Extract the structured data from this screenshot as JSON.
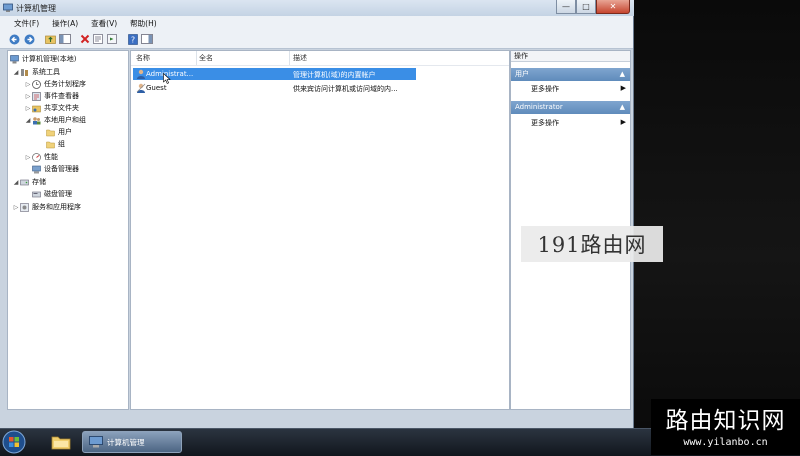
{
  "window": {
    "title": "计算机管理",
    "controls": {
      "minimize": "—",
      "maximize": "□",
      "close": "✕"
    }
  },
  "menu": [
    "文件(F)",
    "操作(A)",
    "查看(V)",
    "帮助(H)"
  ],
  "tree": {
    "items": [
      {
        "label": "计算机管理(本地)",
        "icon": "computer-management-icon"
      },
      {
        "label": "系统工具",
        "icon": "tools-icon",
        "expanded": true
      },
      {
        "label": "任务计划程序",
        "icon": "clock-icon"
      },
      {
        "label": "事件查看器",
        "icon": "event-viewer-icon"
      },
      {
        "label": "共享文件夹",
        "icon": "shared-folder-icon"
      },
      {
        "label": "本地用户和组",
        "icon": "users-icon",
        "expanded": true
      },
      {
        "label": "用户",
        "icon": "folder-icon"
      },
      {
        "label": "组",
        "icon": "folder-icon"
      },
      {
        "label": "性能",
        "icon": "performance-icon"
      },
      {
        "label": "设备管理器",
        "icon": "device-manager-icon"
      },
      {
        "label": "存储",
        "icon": "storage-icon",
        "expanded": true
      },
      {
        "label": "磁盘管理",
        "icon": "disk-icon"
      },
      {
        "label": "服务和应用程序",
        "icon": "services-icon"
      }
    ]
  },
  "list": {
    "columns": [
      "名称",
      "全名",
      "描述"
    ],
    "rows": [
      {
        "name": "Administrat...",
        "fullname": "",
        "description": "管理计算机(域)的内置帐户",
        "selected": true
      },
      {
        "name": "Guest",
        "fullname": "",
        "description": "供来宾访问计算机或访问域的内...",
        "selected": false
      }
    ]
  },
  "actions": {
    "header": "操作",
    "sections": [
      {
        "title": "用户",
        "item": "更多操作"
      },
      {
        "title": "Administrator",
        "item": "更多操作"
      }
    ]
  },
  "taskbar": {
    "active_task": "计算机管理"
  },
  "watermark": {
    "box_text": "191路由网",
    "corner_title": "路由知识网",
    "corner_url": "www.yilanbo.cn"
  },
  "colors": {
    "selection": "#3a8ee6",
    "section_header": "#6b95c4"
  }
}
